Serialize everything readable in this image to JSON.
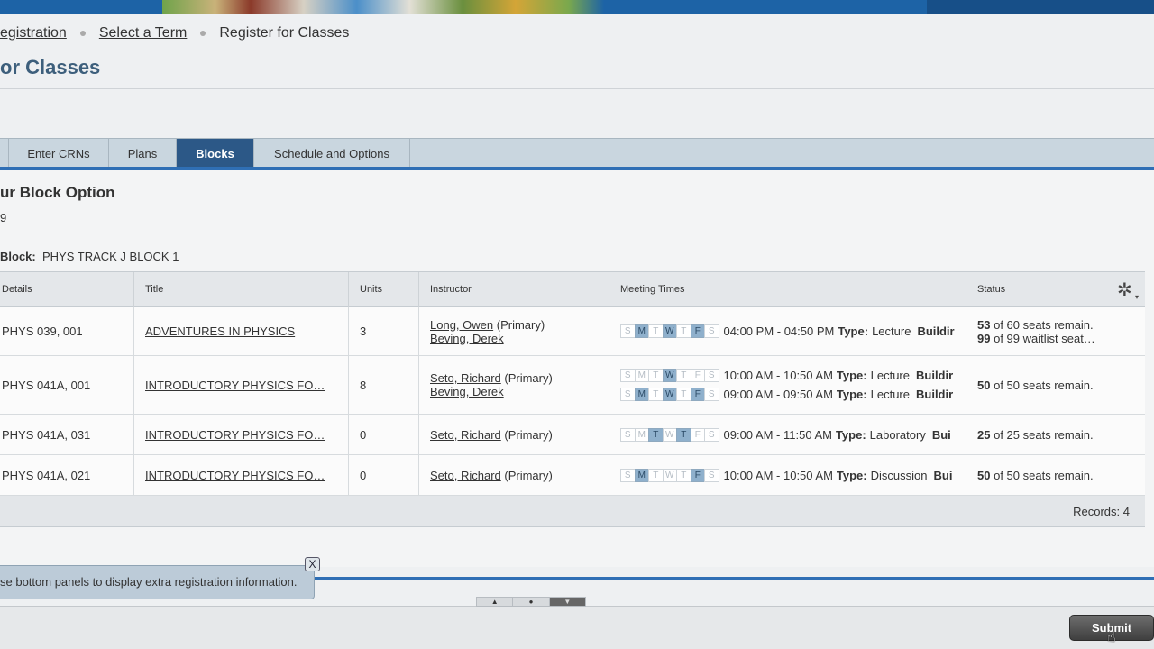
{
  "breadcrumb": {
    "items": [
      "egistration",
      "Select a Term",
      "Register for Classes"
    ]
  },
  "page_title": "or Classes",
  "tabs": [
    {
      "label": "Enter CRNs"
    },
    {
      "label": "Plans"
    },
    {
      "label": "Blocks"
    },
    {
      "label": "Schedule and Options"
    }
  ],
  "section": {
    "title": "ur Block Option",
    "term": "9",
    "block_prefix": "Block:",
    "block_name": "PHYS TRACK J BLOCK 1"
  },
  "table": {
    "headers": [
      "Details",
      "Title",
      "Units",
      "Instructor",
      "Meeting Times",
      "Status"
    ],
    "day_letters": [
      "S",
      "M",
      "T",
      "W",
      "T",
      "F",
      "S"
    ],
    "rows": [
      {
        "details": "PHYS 039, 001",
        "title": "ADVENTURES IN PHYSICS",
        "units": "3",
        "instructors": [
          {
            "name": "Long, Owen",
            "role": "(Primary)"
          },
          {
            "name": "Beving, Derek",
            "role": ""
          }
        ],
        "meetings": [
          {
            "days": [
              false,
              true,
              false,
              true,
              false,
              true,
              false
            ],
            "time": "04:00 PM - 04:50 PM",
            "type_label": "Type:",
            "type": "Lecture",
            "building": "Buildir"
          }
        ],
        "status": [
          {
            "count": "53",
            "text": "of 60 seats remain."
          },
          {
            "count": "99",
            "text": "of 99 waitlist seat…"
          }
        ]
      },
      {
        "details": "PHYS 041A, 001",
        "title": "INTRODUCTORY PHYSICS FO…",
        "units": "8",
        "instructors": [
          {
            "name": "Seto, Richard",
            "role": "(Primary)"
          },
          {
            "name": "Beving, Derek",
            "role": ""
          }
        ],
        "meetings": [
          {
            "days": [
              false,
              false,
              false,
              true,
              false,
              false,
              false
            ],
            "time": "10:00 AM - 10:50 AM",
            "type_label": "Type:",
            "type": "Lecture",
            "building": "Buildir"
          },
          {
            "days": [
              false,
              true,
              false,
              true,
              false,
              true,
              false
            ],
            "time": "09:00 AM - 09:50 AM",
            "type_label": "Type:",
            "type": "Lecture",
            "building": "Buildir"
          }
        ],
        "status": [
          {
            "count": "50",
            "text": "of 50 seats remain."
          }
        ]
      },
      {
        "details": "PHYS 041A, 031",
        "title": "INTRODUCTORY PHYSICS FO…",
        "units": "0",
        "instructors": [
          {
            "name": "Seto, Richard",
            "role": "(Primary)"
          }
        ],
        "meetings": [
          {
            "days": [
              false,
              false,
              true,
              false,
              true,
              false,
              false
            ],
            "time": "09:00 AM - 11:50 AM",
            "type_label": "Type:",
            "type": "Laboratory",
            "building": "Bui"
          }
        ],
        "status": [
          {
            "count": "25",
            "text": "of 25 seats remain."
          }
        ]
      },
      {
        "details": "PHYS 041A, 021",
        "title": "INTRODUCTORY PHYSICS FO…",
        "units": "0",
        "instructors": [
          {
            "name": "Seto, Richard",
            "role": "(Primary)"
          }
        ],
        "meetings": [
          {
            "days": [
              false,
              true,
              false,
              false,
              false,
              true,
              false
            ],
            "time": "10:00 AM - 10:50 AM",
            "type_label": "Type:",
            "type": "Discussion",
            "building": "Bui"
          }
        ],
        "status": [
          {
            "count": "50",
            "text": "of 50 seats remain."
          }
        ]
      }
    ],
    "records_label": "Records: 4"
  },
  "tooltip": {
    "text": "se bottom panels to display extra registration information.",
    "close_label": "X"
  },
  "panel_toggles": [
    "▲",
    "●",
    "▼"
  ],
  "submit_label": "Submit",
  "icons": {
    "settings": "gear-icon",
    "cursor": "hand-pointer-icon"
  },
  "colors": {
    "active_tab": "#2c5887",
    "accent_rule": "#2f6fb5",
    "day_on": "#8fb0cc",
    "title_blue": "#3d5f7c"
  }
}
